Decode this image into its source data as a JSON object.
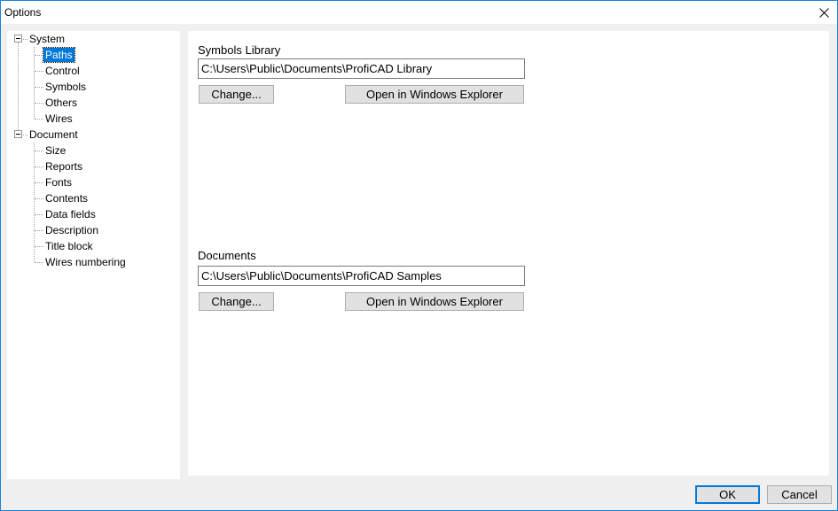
{
  "window": {
    "title": "Options"
  },
  "tree": {
    "system": {
      "label": "System",
      "children": [
        "Paths",
        "Control",
        "Symbols",
        "Others",
        "Wires"
      ]
    },
    "document": {
      "label": "Document",
      "children": [
        "Size",
        "Reports",
        "Fonts",
        "Contents",
        "Data fields",
        "Description",
        "Title block",
        "Wires numbering"
      ]
    },
    "selected": "Paths"
  },
  "symbols_library": {
    "label": "Symbols Library",
    "path": "C:\\Users\\Public\\Documents\\ProfiCAD Library",
    "change_label": "Change...",
    "explorer_label": "Open in Windows Explorer"
  },
  "documents": {
    "label": "Documents",
    "path": "C:\\Users\\Public\\Documents\\ProfiCAD Samples",
    "change_label": "Change...",
    "explorer_label": "Open in Windows Explorer"
  },
  "footer": {
    "ok_label": "OK",
    "cancel_label": "Cancel"
  },
  "colors": {
    "selection": "#0078d7",
    "window_border": "#1883d7",
    "button_face": "#e1e1e1"
  }
}
